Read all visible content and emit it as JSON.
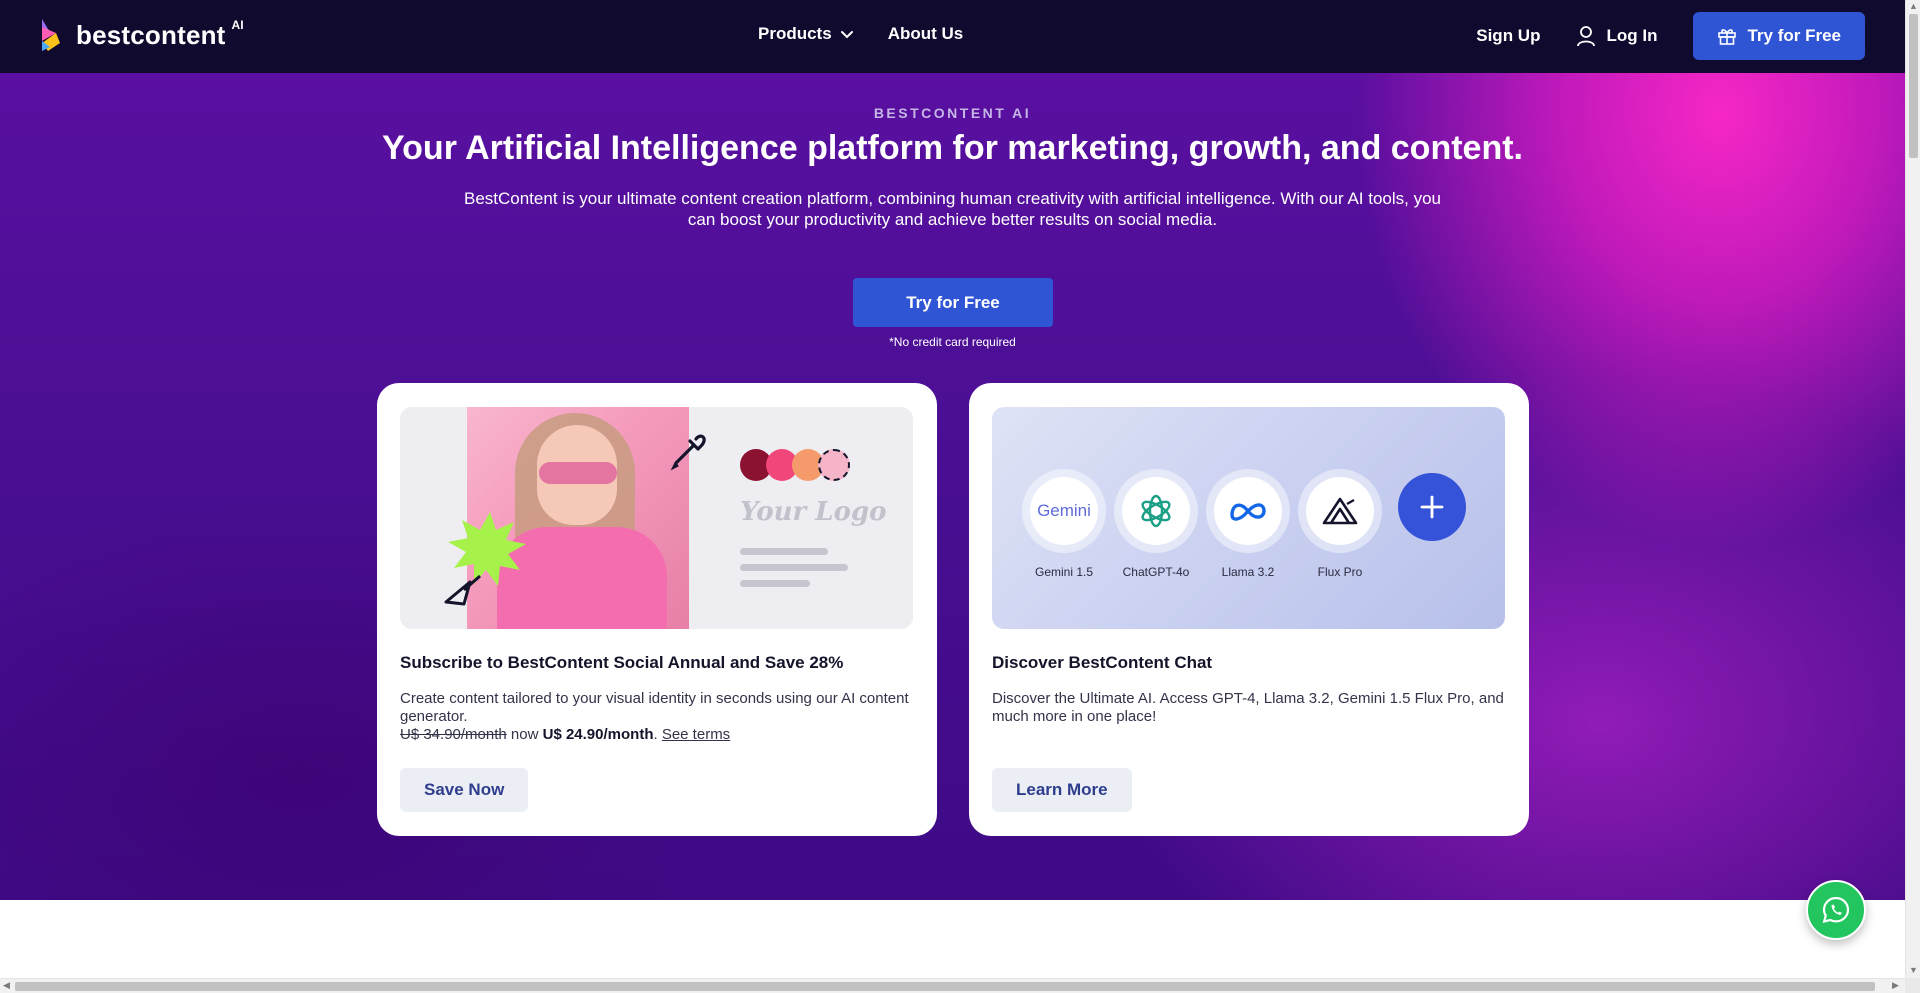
{
  "brand": {
    "name": "bestcontent",
    "superscript": "AI"
  },
  "nav": {
    "products": "Products",
    "about": "About Us",
    "signup": "Sign Up",
    "login": "Log In",
    "try_free": "Try for Free"
  },
  "hero": {
    "eyebrow": "BESTCONTENT AI",
    "title": "Your Artificial Intelligence platform for marketing, growth, and content.",
    "subtitle": "BestContent is your ultimate content creation platform, combining human creativity with artificial intelligence. With our AI tools, you can boost your productivity and achieve better results on social media.",
    "cta": "Try for Free",
    "note": "*No credit card required"
  },
  "cards": [
    {
      "title": "Subscribe to BestContent Social Annual and Save 28%",
      "desc": "Create content tailored to your visual identity in seconds using our AI content generator.",
      "old_price": "U$ 34.90/month",
      "now": " now ",
      "new_price": "U$ 24.90/month",
      "period": ". ",
      "terms": "See terms",
      "button": "Save Now",
      "logo_placeholder": "Your Logo",
      "swatches": [
        "#8b1230",
        "#f0467a",
        "#f59a6b",
        "#f6b4c8"
      ]
    },
    {
      "title": "Discover BestContent Chat",
      "desc": "Discover the Ultimate AI. Access GPT-4, Llama 3.2, Gemini 1.5 Flux Pro, and much more in one place!",
      "button": "Learn More",
      "models": [
        {
          "label": "Gemini 1.5",
          "logo_text": "Gemini",
          "icon": "gemini-icon"
        },
        {
          "label": "ChatGPT-4o",
          "icon": "chatgpt-icon"
        },
        {
          "label": "Llama 3.2",
          "icon": "meta-icon"
        },
        {
          "label": "Flux Pro",
          "icon": "flux-icon"
        }
      ]
    }
  ],
  "colors": {
    "nav_bg": "#0f0a2e",
    "primary": "#2f55d4",
    "hero_purple": "#4b0f95",
    "hero_pink": "#ff28c8",
    "whatsapp": "#22c55e"
  }
}
